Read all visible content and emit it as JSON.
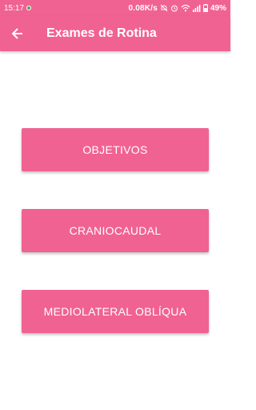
{
  "status_bar": {
    "time": "15:17",
    "network_speed": "0.08K/s",
    "battery_percent": "49%",
    "icons": [
      "whatsapp-icon",
      "mute-icon",
      "alarm-icon",
      "wifi-icon",
      "signal-icon",
      "battery-icon"
    ]
  },
  "app_bar": {
    "title": "Exames de Rotina",
    "back_icon": "arrow-back-icon"
  },
  "buttons": [
    {
      "label": "OBJETIVOS"
    },
    {
      "label": "CRANIOCAUDAL"
    },
    {
      "label": "MEDIOLATERAL OBLÍQUA"
    }
  ],
  "colors": {
    "primary": "#f06292",
    "on_primary": "#ffffff",
    "background": "#ffffff"
  }
}
